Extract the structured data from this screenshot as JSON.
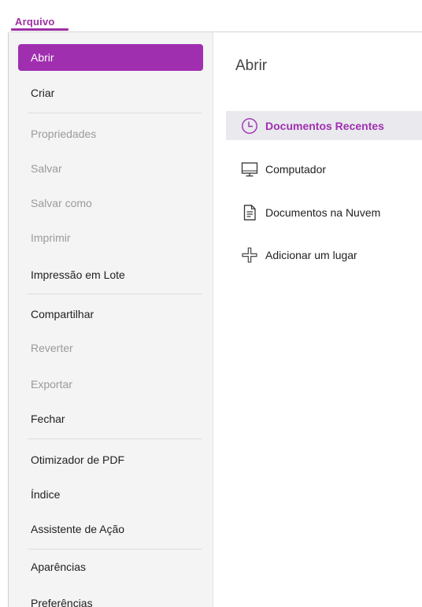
{
  "file_tab": {
    "label": "Arquivo"
  },
  "menu": {
    "items": [
      {
        "label": "Abrir",
        "state": "active"
      },
      {
        "label": "Criar",
        "state": "normal"
      },
      {
        "label": "Propriedades",
        "state": "disabled"
      },
      {
        "label": "Salvar",
        "state": "disabled"
      },
      {
        "label": "Salvar como",
        "state": "disabled"
      },
      {
        "label": "Imprimir",
        "state": "disabled"
      },
      {
        "label": "Impressão em Lote",
        "state": "normal"
      },
      {
        "label": "Compartilhar",
        "state": "normal"
      },
      {
        "label": "Reverter",
        "state": "disabled"
      },
      {
        "label": "Exportar",
        "state": "disabled"
      },
      {
        "label": "Fechar",
        "state": "normal"
      },
      {
        "label": "Otimizador de PDF",
        "state": "normal"
      },
      {
        "label": "Índice",
        "state": "normal"
      },
      {
        "label": "Assistente de Ação",
        "state": "normal"
      },
      {
        "label": "Aparências",
        "state": "normal"
      },
      {
        "label": "Preferências",
        "state": "normal"
      }
    ]
  },
  "main": {
    "title": "Abrir",
    "locations": [
      {
        "label": "Documentos Recentes",
        "icon": "clock-icon",
        "selected": true
      },
      {
        "label": "Computador",
        "icon": "monitor-icon",
        "selected": false
      },
      {
        "label": "Documentos na Nuvem",
        "icon": "document-icon",
        "selected": false
      },
      {
        "label": "Adicionar um lugar",
        "icon": "plus-icon",
        "selected": false
      }
    ]
  },
  "colors": {
    "accent": "#a02fb0",
    "sidebar_bg": "#f4f4f5",
    "selected_bg": "#e9e9ee",
    "disabled_text": "#9a9a9a"
  }
}
